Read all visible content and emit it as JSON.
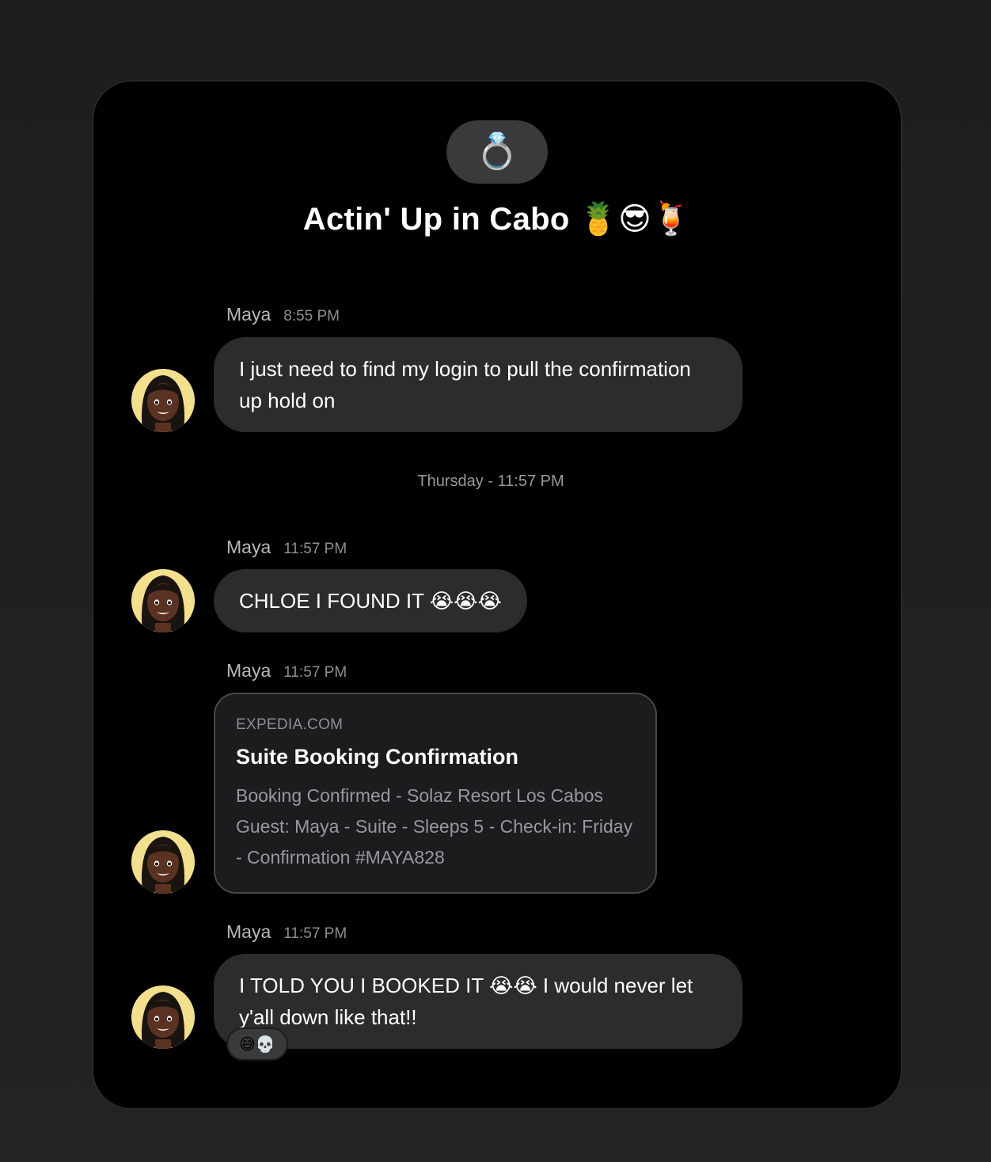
{
  "group": {
    "icon": "💍",
    "title": "Actin' Up in Cabo 🍍😎🍹"
  },
  "messages": [
    {
      "sender": "Maya",
      "time": "8:55 PM",
      "text": "I just need to find my login to pull the confirmation up hold on"
    },
    {
      "sender": "Maya",
      "time": "11:57 PM",
      "text": "CHLOE I FOUND IT 😭😭😭"
    },
    {
      "sender": "Maya",
      "time": "11:57 PM",
      "link": {
        "domain": "EXPEDIA.COM",
        "title": "Suite Booking Confirmation",
        "description": "Booking Confirmed - Solaz Resort Los Cabos Guest: Maya - Suite - Sleeps 5 - Check-in: Friday - Confirmation #MAYA828"
      }
    },
    {
      "sender": "Maya",
      "time": "11:57 PM",
      "text": "I TOLD YOU I BOOKED IT 😭😭 I would never let y'all down like that!!",
      "reactions": "😅💀"
    }
  ],
  "divider": "Thursday - 11:57 PM",
  "colors": {
    "background": "#1e1e20",
    "panel": "#000000",
    "bubble": "#2c2c2e",
    "avatar_bg": "#f2e08f"
  },
  "icons": {
    "avatar": "memoji-avatar-icon"
  }
}
